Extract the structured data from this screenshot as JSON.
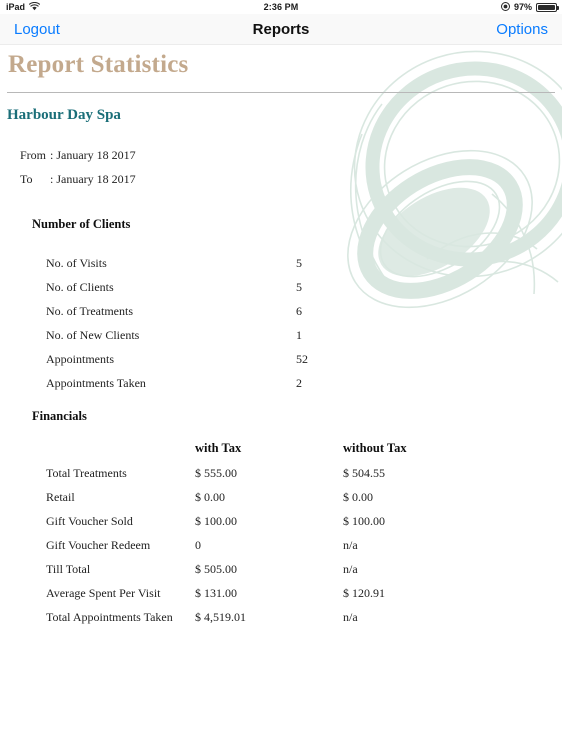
{
  "status_bar": {
    "device": "iPad",
    "wifi_icon": "wifi-icon",
    "time": "2:36 PM",
    "location_icon": "location-services-icon",
    "battery_percent": "97%",
    "battery_icon": "battery-icon"
  },
  "nav": {
    "logout_label": "Logout",
    "title": "Reports",
    "options_label": "Options"
  },
  "report": {
    "title": "Report Statistics",
    "company": "Harbour Day Spa",
    "from_label": "From",
    "from_sep": ": January 18 2017",
    "to_label": "To",
    "to_sep": ": January 18 2017"
  },
  "clients": {
    "heading": "Number of Clients",
    "rows": [
      {
        "label": "No. of Visits",
        "value": "5"
      },
      {
        "label": "No. of Clients",
        "value": "5"
      },
      {
        "label": "No. of Treatments",
        "value": "6"
      },
      {
        "label": "No. of New Clients",
        "value": "1"
      },
      {
        "label": "Appointments",
        "value": "52"
      },
      {
        "label": "Appointments Taken",
        "value": "2"
      }
    ]
  },
  "financials": {
    "heading": "Financials",
    "col_with_tax": "with Tax",
    "col_without_tax": "without Tax",
    "rows": [
      {
        "label": "Total Treatments",
        "with_tax": "$ 555.00",
        "without_tax": "$ 504.55"
      },
      {
        "label": "Retail",
        "with_tax": "$ 0.00",
        "without_tax": "$ 0.00"
      },
      {
        "label": "Gift Voucher Sold",
        "with_tax": "$ 100.00",
        "without_tax": "$ 100.00"
      },
      {
        "label": "Gift Voucher Redeem",
        "with_tax": "0",
        "without_tax": "n/a"
      },
      {
        "label": "Till Total",
        "with_tax": "$ 505.00",
        "without_tax": "n/a"
      },
      {
        "label": "Average Spent Per Visit",
        "with_tax": "$ 131.00",
        "without_tax": "$ 120.91"
      },
      {
        "label": "Total Appointments Taken",
        "with_tax": "$ 4,519.01",
        "without_tax": "n/a"
      }
    ]
  },
  "colors": {
    "title": "#c3a98d",
    "company": "#1a6e78",
    "link": "#0a7cff",
    "watermark": "#d9e7e0"
  }
}
